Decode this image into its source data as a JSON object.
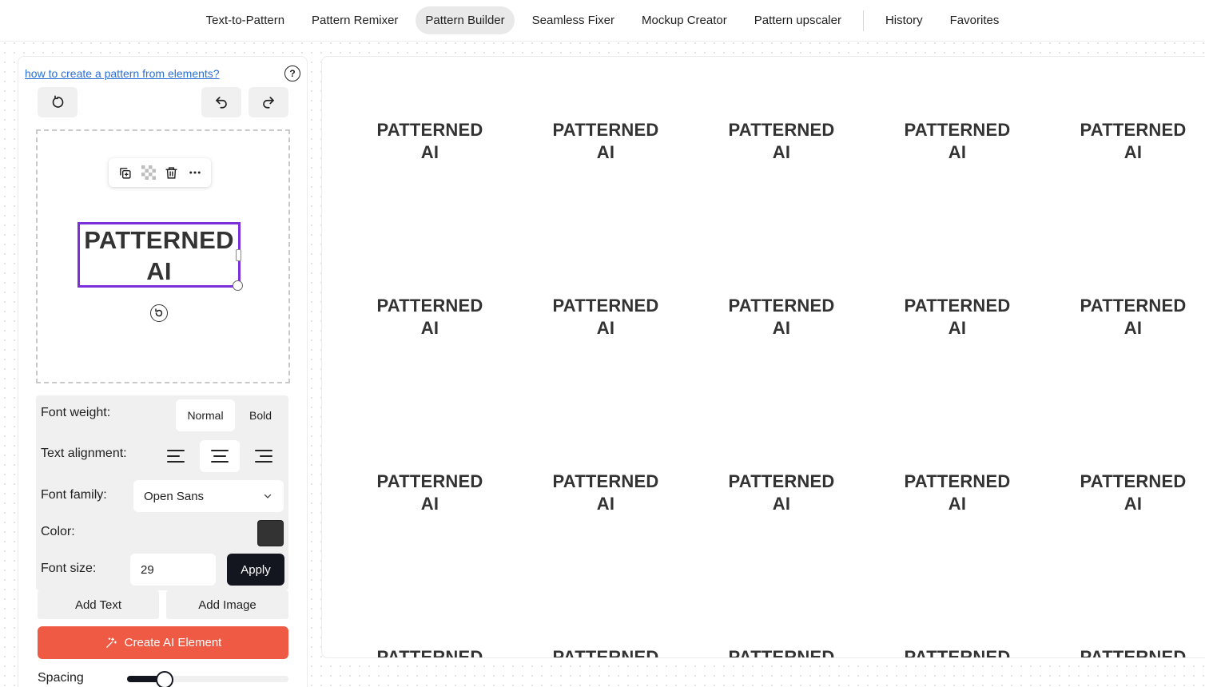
{
  "nav": {
    "items": [
      {
        "label": "Text-to-Pattern",
        "active": false
      },
      {
        "label": "Pattern Remixer",
        "active": false
      },
      {
        "label": "Pattern Builder",
        "active": true
      },
      {
        "label": "Seamless Fixer",
        "active": false
      },
      {
        "label": "Mockup Creator",
        "active": false
      },
      {
        "label": "Pattern upscaler",
        "active": false
      }
    ],
    "secondary": [
      {
        "label": "History"
      },
      {
        "label": "Favorites"
      }
    ]
  },
  "builder": {
    "help_link": "how to create a pattern from elements?",
    "help_icon": "?",
    "element_text_line1": "PATTERNED",
    "element_text_line2": "AI"
  },
  "props": {
    "font_weight_label": "Font weight:",
    "font_weight_options": [
      "Normal",
      "Bold"
    ],
    "font_weight_selected": "Normal",
    "text_alignment_label": "Text alignment:",
    "text_alignment_selected": "center",
    "font_family_label": "Font family:",
    "font_family_value": "Open Sans",
    "color_label": "Color:",
    "color_value": "#333333",
    "font_size_label": "Font size:",
    "font_size_value": "29",
    "apply_label": "Apply"
  },
  "actions": {
    "add_text": "Add Text",
    "add_image": "Add Image",
    "create_ai": "Create AI Element",
    "spacing_label": "Spacing",
    "spacing_fraction": 0.2
  },
  "preview": {
    "tile_line1": "PATTERNED",
    "tile_line2": "AI",
    "columns": 5,
    "rows": 4
  },
  "colors": {
    "accent": "#7a2fd8",
    "create_button": "#ef5a44",
    "dark_button": "#13151f"
  }
}
